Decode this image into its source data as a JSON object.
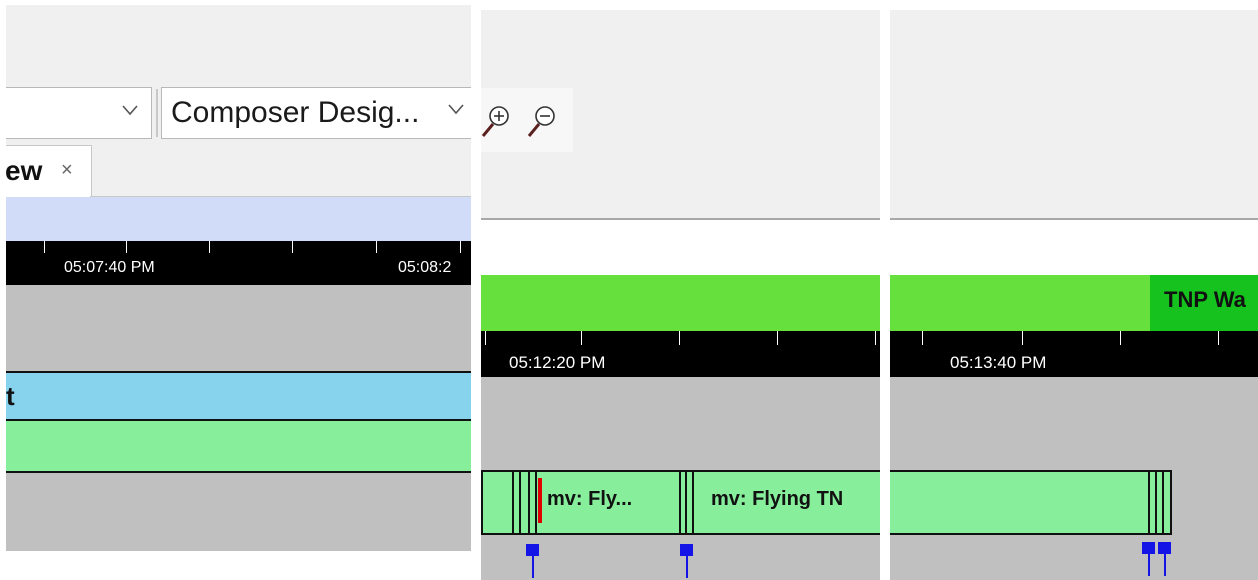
{
  "panel_left": {
    "dropdown_1": {
      "value": ""
    },
    "dropdown_2": {
      "value": "Composer Desig..."
    },
    "tab": {
      "label": "ew",
      "close": "×"
    },
    "ruler": {
      "labels": [
        "05:07:40 PM",
        "05:08:2"
      ]
    },
    "tracks": {
      "blue_label": "t"
    }
  },
  "panel_middle": {
    "ruler": {
      "labels": [
        "05:12:20 PM"
      ]
    },
    "clips": [
      "mv: Fly...",
      "mv: Flying TN"
    ]
  },
  "panel_right": {
    "green_label": "TNP Wa",
    "ruler": {
      "labels": [
        "05:13:40 PM"
      ]
    }
  },
  "colors": {
    "timeline_bg": "#c0c0c0",
    "blue_track": "#87d3ee",
    "green_track": "#87ee9c",
    "bright_green": "#66e03c",
    "dark_green": "#16c21e",
    "marker_blue": "#1414e6",
    "playhead_red": "#e00000"
  },
  "icons": [
    "chevron-down-icon",
    "close-icon",
    "zoom-in-icon",
    "zoom-out-icon"
  ]
}
